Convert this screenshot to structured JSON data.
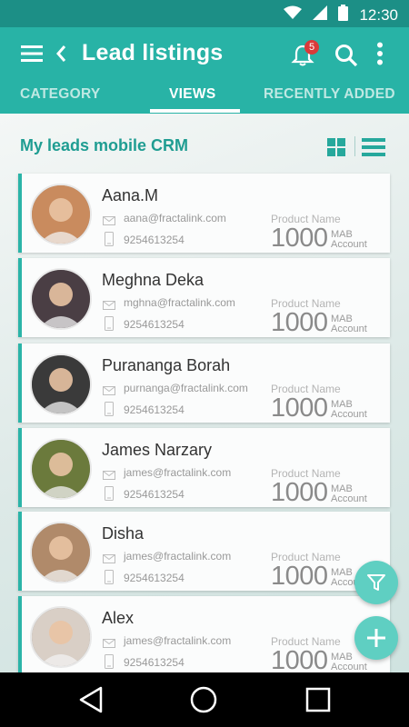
{
  "status_bar": {
    "time": "12:30"
  },
  "app_bar": {
    "title": "Lead listings",
    "notification_count": "5",
    "tabs": [
      {
        "label": "CATEGORY",
        "active": false
      },
      {
        "label": "VIEWS",
        "active": true
      },
      {
        "label": "RECENTLY ADDED",
        "active": false
      }
    ]
  },
  "content": {
    "section_title": "My leads mobile CRM"
  },
  "leads": [
    {
      "name": "Aana.M",
      "email": "aana@fractalink.com",
      "phone": "9254613254",
      "product_label": "Product Name",
      "product_value": "1000",
      "unit_line1": "MAB",
      "unit_line2": "Account",
      "avatar_color": "#c98b5e"
    },
    {
      "name": "Meghna Deka",
      "email": "mghna@fractalink.com",
      "phone": "9254613254",
      "product_label": "Product Name",
      "product_value": "1000",
      "unit_line1": "MAB",
      "unit_line2": "Account",
      "avatar_color": "#4a3e44"
    },
    {
      "name": "Purananga Borah",
      "email": "purnanga@fractalink.com",
      "phone": "9254613254",
      "product_label": "Product Name",
      "product_value": "1000",
      "unit_line1": "MAB",
      "unit_line2": "Account",
      "avatar_color": "#3a3a3a"
    },
    {
      "name": "James Narzary",
      "email": "james@fractalink.com",
      "phone": "9254613254",
      "product_label": "Product Name",
      "product_value": "1000",
      "unit_line1": "MAB",
      "unit_line2": "Account",
      "avatar_color": "#6b7a3c"
    },
    {
      "name": "Disha",
      "email": "james@fractalink.com",
      "phone": "9254613254",
      "product_label": "Product Name",
      "product_value": "1000",
      "unit_line1": "MAB",
      "unit_line2": "Account",
      "avatar_color": "#b08a6a"
    },
    {
      "name": "Alex",
      "email": "james@fractalink.com",
      "phone": "9254613254",
      "product_label": "Product Name",
      "product_value": "1000",
      "unit_line1": "MAB",
      "unit_line2": "Account",
      "avatar_color": "#d9cfc6"
    }
  ],
  "colors": {
    "primary": "#28b3a6",
    "accent": "#5fcfc2",
    "badge": "#d93a3a"
  }
}
